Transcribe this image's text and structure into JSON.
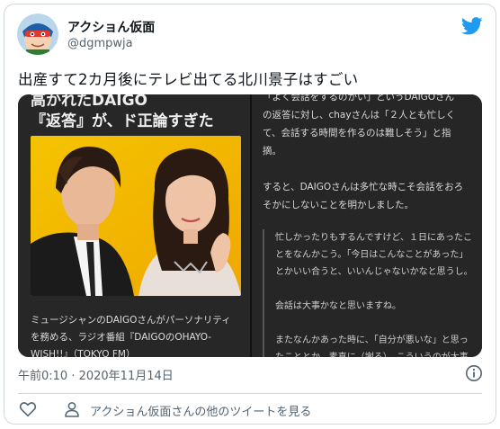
{
  "author": {
    "name": "アクショん仮面",
    "handle": "@dgmpwja"
  },
  "tweet": {
    "text": "出産すて2カ月後にテレビ出てる北川景子はすごい",
    "timestamp": "午前0:10 · 2020年11月14日"
  },
  "media": {
    "left": {
      "headline_cut": "高かれたDAIGO",
      "headline": "『返答』が、ド正論すぎた",
      "body": [
        "ミュージシャンのDAIGOさんがパーソナリティ",
        "を務める、ラジオ番組『DAIGOのOHAYO-",
        "WISH!!』（TOKYO FM）"
      ]
    },
    "right": {
      "body": [
        "「よく会話をするのかい」というDAIGOさん",
        "の返答に対し、chayさんは「２人とも忙しく",
        "て、会話する時間を作るのは難しそう」と指",
        "摘。",
        "",
        "すると、DAIGOさんは多忙な時こそ会話をおろ",
        "そかにしないことを明かしました。"
      ],
      "quote": [
        "忙しかったりもするんですけど、１日にあったこ",
        "とをなんかこう。「今日はこんなことがあった」",
        "とかいい合うと、いいんじゃないかなと思うし。",
        "",
        "会話は大事かなと思いますね。",
        "",
        "またなんかあった時に、「自分が悪いな」と思っ",
        "たこととか、素直に（謝る）。こういうのが大事"
      ]
    }
  },
  "actions": {
    "more_tweets": "アクショん仮面さんの他のツイートを見る"
  },
  "icons": {
    "twitter": "twitter-bird-icon",
    "info": "info-icon",
    "like": "heart-icon",
    "profile": "person-icon"
  },
  "colors": {
    "twitter_blue": "#1d9bf0",
    "text_primary": "#0f1419",
    "text_secondary": "#536471"
  }
}
